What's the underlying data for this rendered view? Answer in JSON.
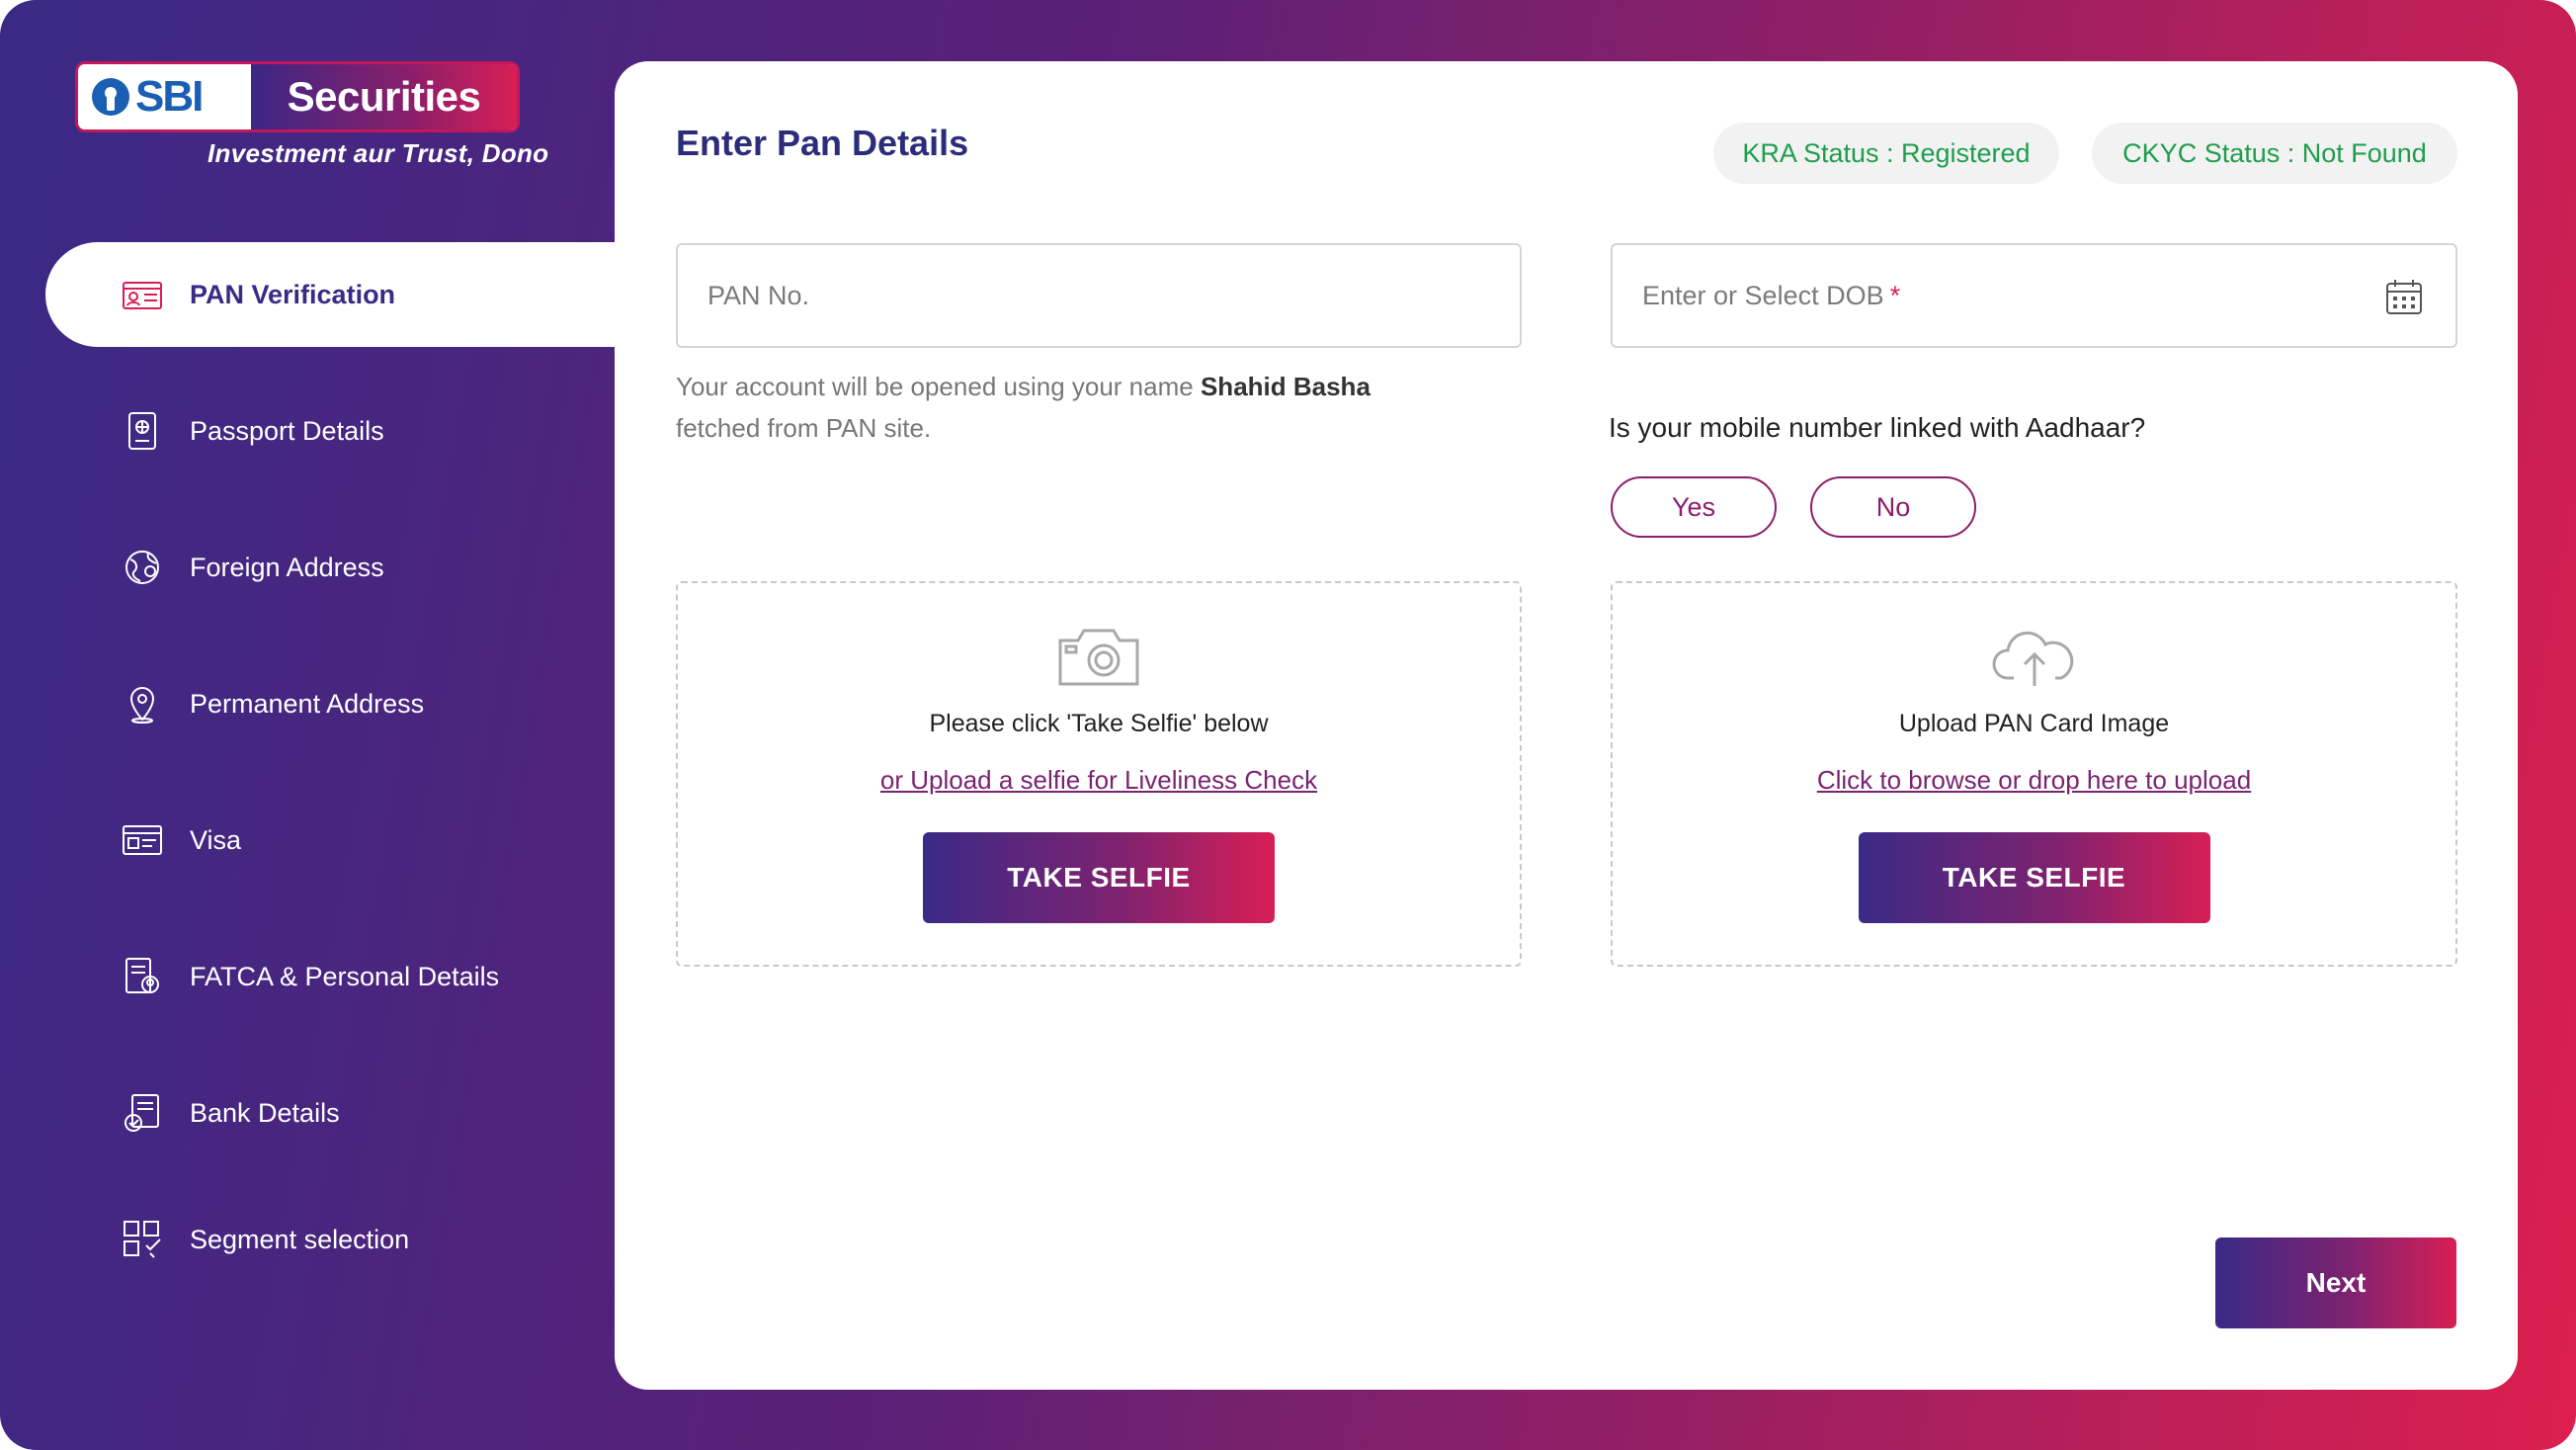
{
  "brand": {
    "logo_sbi": "SBI",
    "logo_securities": "Securities",
    "tagline": "Investment aur Trust, Dono"
  },
  "sidebar": {
    "items": [
      {
        "label": "PAN Verification",
        "icon": "id-card-icon",
        "active": true
      },
      {
        "label": "Passport Details",
        "icon": "passport-icon",
        "active": false
      },
      {
        "label": "Foreign Address",
        "icon": "globe-icon",
        "active": false
      },
      {
        "label": "Permanent Address",
        "icon": "location-pin-icon",
        "active": false
      },
      {
        "label": "Visa",
        "icon": "visa-card-icon",
        "active": false
      },
      {
        "label": "FATCA & Personal Details",
        "icon": "personal-document-icon",
        "active": false
      },
      {
        "label": "Bank Details",
        "icon": "bank-document-icon",
        "active": false
      },
      {
        "label": "Segment selection",
        "icon": "segment-grid-icon",
        "active": false
      }
    ]
  },
  "main": {
    "title": "Enter Pan Details",
    "kra_status": "KRA Status : Registered",
    "ckyc_status": "CKYC Status : Not Found",
    "pan_placeholder": "PAN No.",
    "dob_placeholder": "Enter or Select DOB",
    "dob_required_mark": "*",
    "hint_prefix": "Your account will be opened using your name",
    "hint_name": "Shahid Basha",
    "hint_suffix": "fetched from PAN site.",
    "aadhaar_question": "Is your mobile number linked with Aadhaar?",
    "yes_label": "Yes",
    "no_label": "No",
    "selfie_box": {
      "title": "Please click 'Take Selfie' below",
      "link": "or Upload a selfie for Liveliness Check",
      "button": "TAKE SELFIE",
      "icon": "camera-icon"
    },
    "pan_box": {
      "title": "Upload PAN Card Image",
      "link": "Click to browse or drop here to upload",
      "button": "TAKE SELFIE",
      "icon": "cloud-upload-icon"
    },
    "next_label": "Next"
  },
  "colors": {
    "gradient_start": "#3a2a86",
    "gradient_end": "#dd1f4e",
    "status_green": "#1e9e4b",
    "title_navy": "#2b2d7a"
  }
}
